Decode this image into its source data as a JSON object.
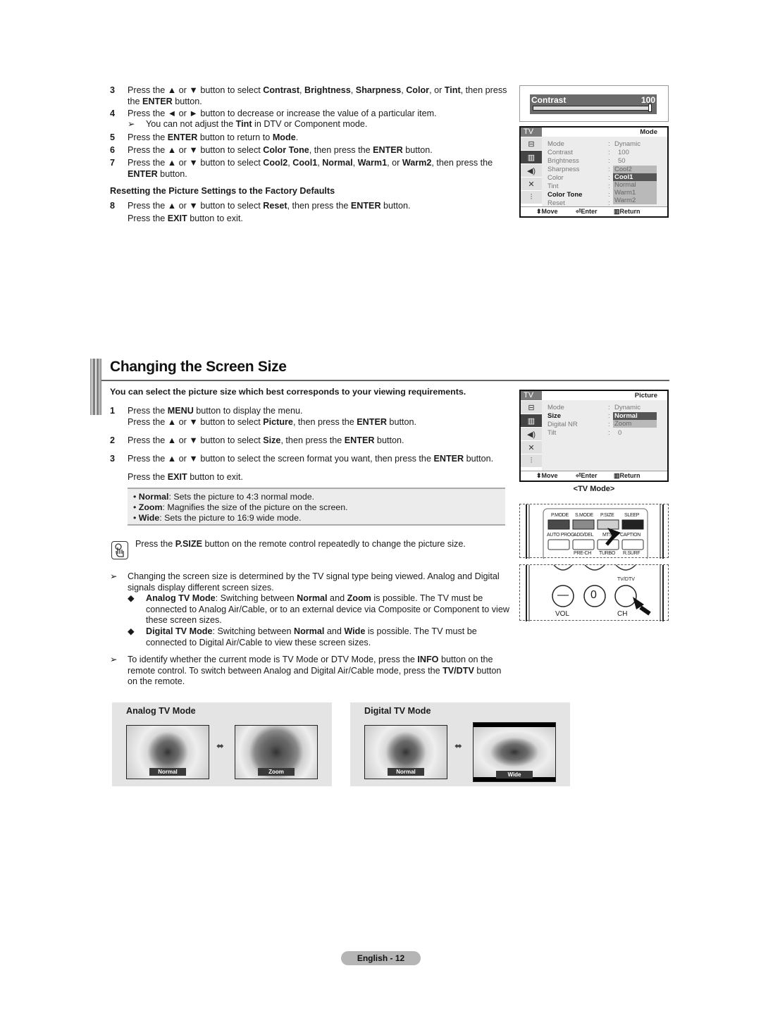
{
  "top_steps": [
    {
      "num": "3",
      "html": "Press the ▲ or ▼ button to select <b>Contrast</b>, <b>Brightness</b>, <b>Sharpness</b>, <b>Color</b>, or <b>Tint</b>, then press the <b>ENTER</b> button."
    },
    {
      "num": "4",
      "html": "Press the ◄ or ► button to decrease or increase the value of a particular item."
    },
    {
      "num": "5",
      "html": "Press the <b>ENTER</b> button to return to <b>Mode</b>."
    },
    {
      "num": "6",
      "html": "Press the ▲ or ▼ button to select <b>Color Tone</b>, then press the <b>ENTER</b> button."
    },
    {
      "num": "7",
      "html": "Press the ▲ or ▼ button to select <b>Cool2</b>, <b>Cool1</b>, <b>Normal</b>, <b>Warm1</b>, or <b>Warm2</b>, then press the <b>ENTER</b> button."
    },
    {
      "num": "8",
      "html": "Press the ▲ or ▼ button to select <b>Reset</b>, then press the <b>ENTER</b> button.<br>Press the <b>EXIT</b> button to exit."
    }
  ],
  "tint_note": "You can not adjust the <b>Tint</b> in DTV or Component mode.",
  "reset_heading": "Resetting the Picture Settings to the Factory Defaults",
  "arrow_glyph": "➢",
  "contrast_box": {
    "label": "Contrast",
    "value": "100",
    "level_pct": 100
  },
  "osd1": {
    "tv_label": "TV",
    "title": "Mode",
    "rows": [
      {
        "label": "Mode",
        "value": "Dynamic"
      },
      {
        "label": "Contrast",
        "value": "100"
      },
      {
        "label": "Brightness",
        "value": "50"
      },
      {
        "label": "Sharpness",
        "value": ""
      },
      {
        "label": "Color",
        "value": ""
      },
      {
        "label": "Tint",
        "value": ""
      },
      {
        "label": "Color Tone",
        "value": "",
        "active": true
      },
      {
        "label": "Reset",
        "value": ""
      }
    ],
    "options": [
      "Cool2",
      "Cool1",
      "Normal",
      "Warm1",
      "Warm2"
    ],
    "selected_option": "Cool1",
    "footer": {
      "move": "Move",
      "enter": "Enter",
      "return": "Return"
    }
  },
  "section": {
    "title": "Changing the Screen Size",
    "intro": "You can select the picture size which best corresponds to your viewing requirements.",
    "steps": [
      {
        "num": "1",
        "html": "Press the <b>MENU</b> button to display the menu.<br>Press the ▲ or ▼ button to select <b>Picture</b>, then press the <b>ENTER</b> button."
      },
      {
        "num": "2",
        "html": "Press the ▲ or ▼ button to select <b>Size</b>, then press the <b>ENTER</b> button."
      },
      {
        "num": "3",
        "html": "Press the ▲ or ▼ button to select the screen format you want, then press the <b>ENTER</b> button."
      }
    ],
    "exit_line": "Press the <b>EXIT</b> button to exit.",
    "bullets": [
      "<b>Normal</b>: Sets the picture to 4:3 normal mode.",
      "<b>Zoom</b>: Magnifies the size of the picture on the screen.",
      "<b>Wide</b>: Sets the picture to 16:9 wide mode."
    ],
    "remote_note": "Press the <b>P.SIZE</b> button on the remote control repeatedly to change the picture size.",
    "notes": [
      "Changing the screen size is determined by the TV signal type being viewed. Analog and Digital signals display different screen sizes.",
      "To identify whether the current mode is TV Mode or DTV Mode, press the <b>INFO</b> button on the remote control. To switch between Analog and Digital Air/Cable mode, press the <b>TV/DTV</b> button on the remote."
    ],
    "sub_bullets": [
      "<b>Analog TV Mode</b>: Switching between <b>Normal</b> and <b>Zoom</b> is possible. The TV must be connected to Analog Air/Cable, or to an external device via Composite or Component to view these screen sizes.",
      "<b>Digital TV Mode</b>: Switching between <b>Normal</b> and <b>Wide</b> is possible. The TV must be connected to Digital Air/Cable to view these screen sizes."
    ]
  },
  "osd2": {
    "tv_label": "TV",
    "title": "Picture",
    "rows": [
      {
        "label": "Mode",
        "value": "Dynamic"
      },
      {
        "label": "Size",
        "value": "",
        "active": true
      },
      {
        "label": "Digital NR",
        "value": ""
      },
      {
        "label": "Tilt",
        "value": "0"
      }
    ],
    "options": [
      "Normal",
      "Zoom"
    ],
    "selected_option": "Normal",
    "footer": {
      "move": "Move",
      "enter": "Enter",
      "return": "Return"
    },
    "caption": "<TV Mode>"
  },
  "remote": {
    "row1": [
      "P.MODE",
      "S.MODE",
      "P.SIZE",
      "SLEEP"
    ],
    "row2": [
      "AUTO PROG.",
      "ADD/DEL",
      "MTS",
      "CAPTION"
    ],
    "row3": [
      "PRE-CH",
      "TURBO",
      "R.SURF"
    ],
    "tvdtv": "TV/DTV",
    "vol": "VOL",
    "ch": "CH",
    "zero": "0",
    "minus": "—"
  },
  "panels": [
    {
      "title": "Analog TV Mode",
      "images": [
        "Normal",
        "Zoom"
      ]
    },
    {
      "title": "Digital TV Mode",
      "images": [
        "Normal",
        "Wide"
      ]
    }
  ],
  "page_label": "English - 12"
}
